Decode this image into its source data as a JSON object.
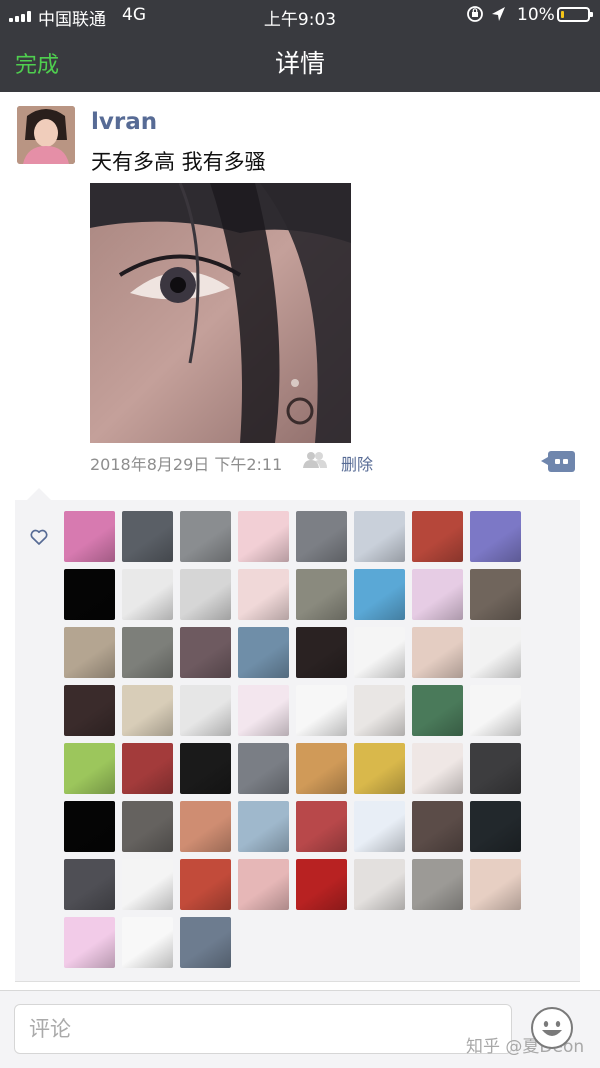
{
  "status_bar": {
    "carrier": "中国联通",
    "network": "4G",
    "time": "上午9:03",
    "battery": "10%",
    "battery_level": 0.1
  },
  "nav": {
    "done_label": "完成",
    "title": "详情"
  },
  "post": {
    "author": "lvran",
    "text": "天有多高 我有多骚",
    "timestamp": "2018年8月29日 下午2:11",
    "delete_label": "删除"
  },
  "likes": {
    "avatars": [
      "#d77ab0",
      "#5a5f66",
      "#8a8d90",
      "#f2cfd5",
      "#7c7f85",
      "#c9d0da",
      "#b6473a",
      "#7c78c6",
      "#050505",
      "#e9e9e9",
      "#d6d6d6",
      "#f0d8d8",
      "#8a8a7e",
      "#5aa8d6",
      "#e6cce4",
      "#70655c",
      "#b4a591",
      "#7d7f7a",
      "#6e5a60",
      "#6f8ea8",
      "#2a2222",
      "#f5f5f5",
      "#e4cdc2",
      "#f2f2f2",
      "#3a2b2b",
      "#d8cdb8",
      "#e6e6e6",
      "#f3e6ee",
      "#f7f7f7",
      "#e9e6e4",
      "#4a7a5a",
      "#f6f6f6",
      "#9cc65c",
      "#a33b3b",
      "#1a1a1a",
      "#7a7e85",
      "#d09a58",
      "#d9b84b",
      "#efe7e5",
      "#3d3d3f",
      "#050505",
      "#65625f",
      "#cf8d72",
      "#9fb8cc",
      "#b8484a",
      "#e8eef6",
      "#5b4c48",
      "#22282c",
      "#4f4f55",
      "#f4f4f4",
      "#c24b3a",
      "#e6b7b7",
      "#b82222",
      "#e3e0de",
      "#9c9a96",
      "#e7cfc3",
      "#f2cbe8",
      "#f8f8f8",
      "#6d7c8f"
    ]
  },
  "footer": {
    "comment_placeholder": "评论",
    "watermark": "知乎 @夏Deon"
  }
}
